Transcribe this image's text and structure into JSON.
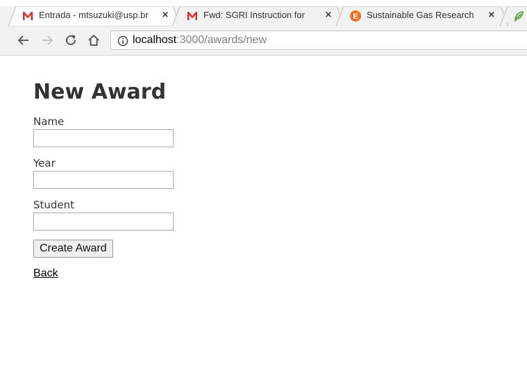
{
  "browser": {
    "tabs": [
      {
        "title": "Entrada - mtsuzuki@usp.br",
        "icon": "gmail-icon",
        "close": "×"
      },
      {
        "title": "Fwd: SGRI Instruction for",
        "icon": "gmail-icon",
        "close": "×"
      },
      {
        "title": "Sustainable Gas Research",
        "icon": "sgri-e-icon",
        "icon_letter": "E",
        "close": "×"
      },
      {
        "title": "",
        "icon": "leaf-icon"
      }
    ],
    "url": {
      "host": "localhost",
      "path": ":3000/awards/new"
    }
  },
  "page": {
    "title": "New Award",
    "fields": [
      {
        "label": "Name",
        "value": ""
      },
      {
        "label": "Year",
        "value": ""
      },
      {
        "label": "Student",
        "value": ""
      }
    ],
    "submit_label": "Create Award",
    "back_label": "Back"
  },
  "colors": {
    "gmail_red": "#d93025",
    "sgri_orange": "#f26e22",
    "leaf_green": "#6aa84f"
  }
}
